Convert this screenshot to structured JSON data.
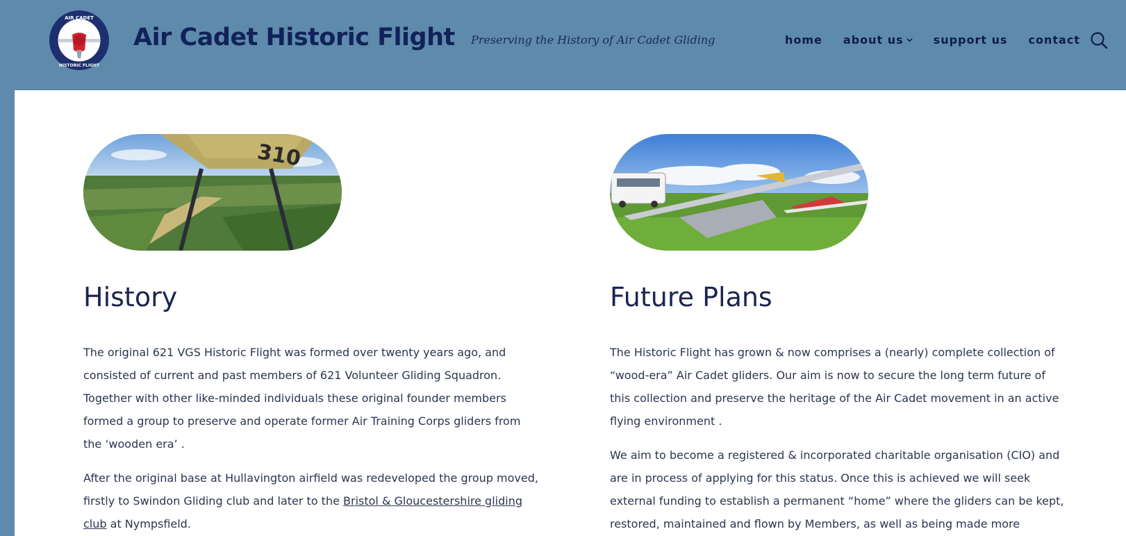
{
  "header": {
    "site_title": "Air Cadet Historic Flight",
    "tagline": "Preserving the History of Air Cadet Gliding",
    "logo_text_top": "AIR CADET",
    "logo_text_bottom": "HISTORIC FLIGHT",
    "nav": [
      {
        "label": "home"
      },
      {
        "label": "about us",
        "has_dropdown": true
      },
      {
        "label": "support us"
      },
      {
        "label": "contact"
      }
    ],
    "search_icon": "search-icon"
  },
  "sections": {
    "history": {
      "image_icon": "aerial-view-from-glider-photo",
      "title": "History",
      "paragraphs": [
        "The original 621 VGS Historic Flight was formed over twenty years ago, and consisted of current and past members of 621 Volunteer Gliding Squadron. Together with other like-minded individuals these original founder members formed a group to preserve and operate former Air Training Corps gliders from the ‘wooden era’ ."
      ],
      "para2_before": "After the original base at Hullavington airfield was redeveloped the group moved, firstly to Swindon Gliding club and later to the ",
      "para2_link": "Bristol & Gloucestershire gliding club",
      "para2_after": " at Nympsfield."
    },
    "future": {
      "image_icon": "gliders-on-airfield-photo",
      "title": "Future Plans",
      "paragraphs": [
        "The Historic Flight has grown & now comprises a (nearly) complete collection of “wood-era” Air Cadet gliders. Our aim is now to secure the long term future of this collection and preserve the heritage of the Air Cadet movement in an active flying environment .",
        "We aim to become a registered & incorporated charitable organisation (CIO) and are in process of applying for this status. Once this is achieved we will seek external funding to establish a permanent “home” where the gliders can be kept, restored, maintained and flown by Members, as well as being made more available to the wider public to view for historic & educational purposes."
      ]
    }
  },
  "colors": {
    "header_bg": "#5e8aab",
    "title_text": "#11225a",
    "body_text": "#2b3550"
  }
}
